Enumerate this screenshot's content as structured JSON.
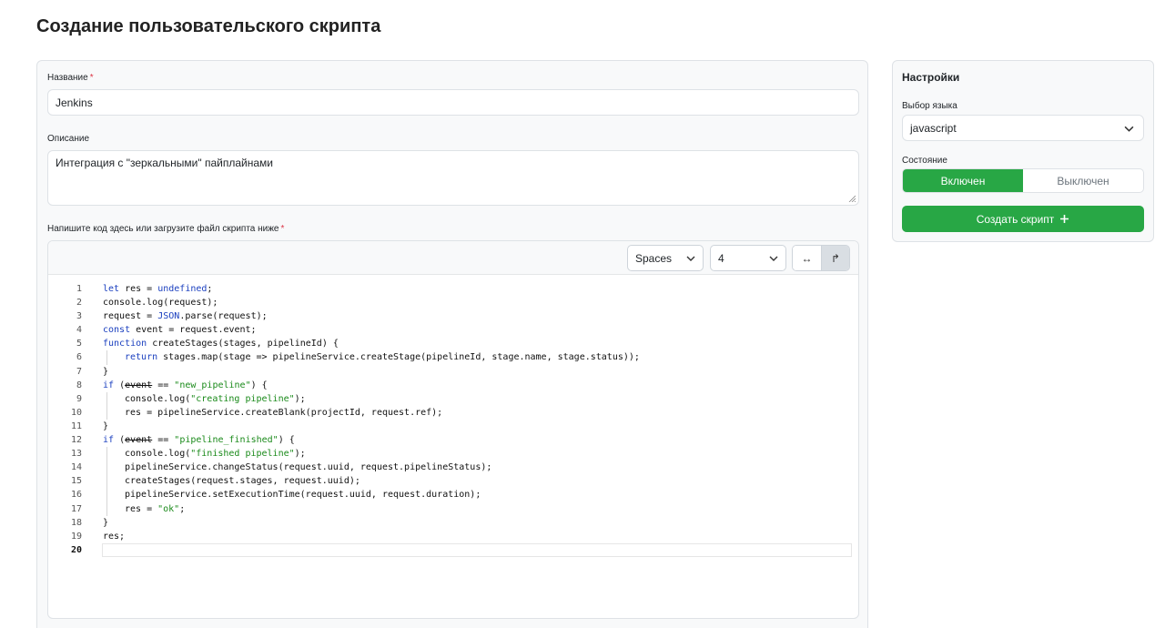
{
  "page": {
    "title": "Создание пользовательского скрипта"
  },
  "form": {
    "name_label": "Название",
    "required_mark": "*",
    "name_value": "Jenkins",
    "description_label": "Описание",
    "description_value": "Интеграция с \"зеркальными\" пайплайнами",
    "code_label": "Напишите код здесь или загрузите файл скрипта ниже"
  },
  "editor": {
    "indent_type": "Spaces",
    "indent_size": "4",
    "wrap_off_glyph": "↔",
    "wrap_on_glyph": "↱",
    "lines": [
      {
        "n": "1"
      },
      {
        "n": "2"
      },
      {
        "n": "3"
      },
      {
        "n": "4"
      },
      {
        "n": "5"
      },
      {
        "n": "6"
      },
      {
        "n": "7"
      },
      {
        "n": "8"
      },
      {
        "n": "9"
      },
      {
        "n": "10"
      },
      {
        "n": "11"
      },
      {
        "n": "12"
      },
      {
        "n": "13"
      },
      {
        "n": "14"
      },
      {
        "n": "15"
      },
      {
        "n": "16"
      },
      {
        "n": "17"
      },
      {
        "n": "18"
      },
      {
        "n": "19"
      },
      {
        "n": "20"
      }
    ],
    "tokens": {
      "l1a": "let",
      "l1b": " res = ",
      "l1c": "undefined",
      "l1d": ";",
      "l2": "console.log(request);",
      "l3a": "request = ",
      "l3b": "JSON",
      "l3c": ".parse(request);",
      "l4a": "const",
      "l4b": " event = request.event;",
      "l5a": "function",
      "l5b": " createStages(stages, pipelineId) {",
      "l6a": "return",
      "l6b": " stages.map(stage => pipelineService.createStage(pipelineId, stage.name, stage.status));",
      "l7": "}",
      "l8a": "if",
      "l8b": " (",
      "l8c": "event",
      "l8d": " == ",
      "l8e": "\"new_pipeline\"",
      "l8f": ") {",
      "l9a": "console.log(",
      "l9b": "\"creating pipeline\"",
      "l9c": ");",
      "l10": "res = pipelineService.createBlank(projectId, request.ref);",
      "l11": "}",
      "l12a": "if",
      "l12b": " (",
      "l12c": "event",
      "l12d": " == ",
      "l12e": "\"pipeline_finished\"",
      "l12f": ") {",
      "l13a": "console.log(",
      "l13b": "\"finished pipeline\"",
      "l13c": ");",
      "l14": "pipelineService.changeStatus(request.uuid, request.pipelineStatus);",
      "l15": "createStages(request.stages, request.uuid);",
      "l16": "pipelineService.setExecutionTime(request.uuid, request.duration);",
      "l17a": "res = ",
      "l17b": "\"ok\"",
      "l17c": ";",
      "l18": "}",
      "l19": "res;"
    }
  },
  "settings": {
    "title": "Настройки",
    "language_label": "Выбор языка",
    "language_value": "javascript",
    "state_label": "Состояние",
    "state_on": "Включен",
    "state_off": "Выключен",
    "create_button": "Создать скрипт",
    "create_icon": "plus-icon"
  },
  "colors": {
    "accent_green": "#28a745",
    "keyword_blue": "#1a3fbf",
    "string_green": "#1a8a1a",
    "required_red": "#dc3545"
  }
}
